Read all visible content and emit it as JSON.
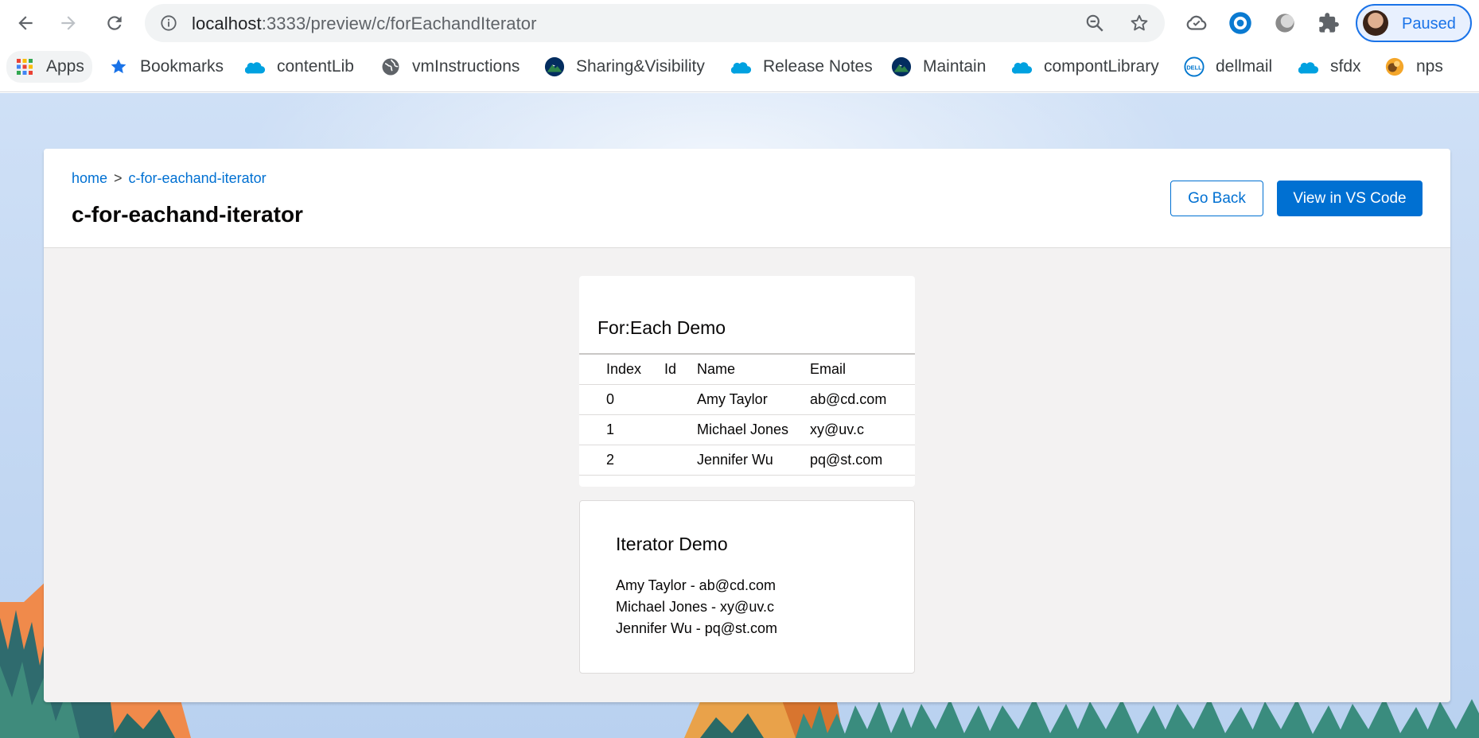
{
  "browser": {
    "url_host": "localhost",
    "url_path": ":3333/preview/c/forEachandIterator",
    "profile_label": "Paused",
    "icons": [
      "back-icon",
      "forward-icon",
      "reload-icon",
      "info-icon",
      "zoom-out-icon",
      "star-icon",
      "cloud-icon",
      "circle-ext-icon",
      "moon-ext-icon",
      "puzzle-icon"
    ]
  },
  "bookmarks": [
    {
      "label": "Apps",
      "icon": "apps-grid-icon"
    },
    {
      "label": "Bookmarks",
      "icon": "star-icon"
    },
    {
      "label": "contentLib",
      "icon": "salesforce-cloud-icon"
    },
    {
      "label": "vmInstructions",
      "icon": "globe-icon"
    },
    {
      "label": "Sharing&Visibility",
      "icon": "trailhead-mountain-icon"
    },
    {
      "label": "Release Notes",
      "icon": "salesforce-cloud-icon"
    },
    {
      "label": "Maintain",
      "icon": "trailhead-mountain-icon"
    },
    {
      "label": "compontLibrary",
      "icon": "salesforce-cloud-icon"
    },
    {
      "label": "dellmail",
      "icon": "dell-icon"
    },
    {
      "label": "sfdx",
      "icon": "salesforce-cloud-icon"
    },
    {
      "label": "nps",
      "icon": "nps-icon"
    }
  ],
  "header": {
    "breadcrumb_home": "home",
    "breadcrumb_sep": ">",
    "breadcrumb_current": "c-for-eachand-iterator",
    "title": "c-for-eachand-iterator",
    "go_back": "Go Back",
    "view_vscode": "View in VS Code"
  },
  "foreach": {
    "title": "For:Each Demo",
    "columns": [
      "Index",
      "Id",
      "Name",
      "Email"
    ],
    "rows": [
      {
        "index": "0",
        "id": "",
        "name": "Amy Taylor",
        "email": "ab@cd.com"
      },
      {
        "index": "1",
        "id": "",
        "name": "Michael Jones",
        "email": "xy@uv.c"
      },
      {
        "index": "2",
        "id": "",
        "name": "Jennifer Wu",
        "email": "pq@st.com"
      }
    ]
  },
  "iterator": {
    "title": "Iterator Demo",
    "items": [
      "Amy Taylor - ab@cd.com",
      "Michael Jones - xy@uv.c",
      "Jennifer Wu - pq@st.com"
    ]
  },
  "colors": {
    "brand": "#0070d2",
    "profile_accent": "#1a73e8",
    "page_bg": "#f3f2f2"
  }
}
